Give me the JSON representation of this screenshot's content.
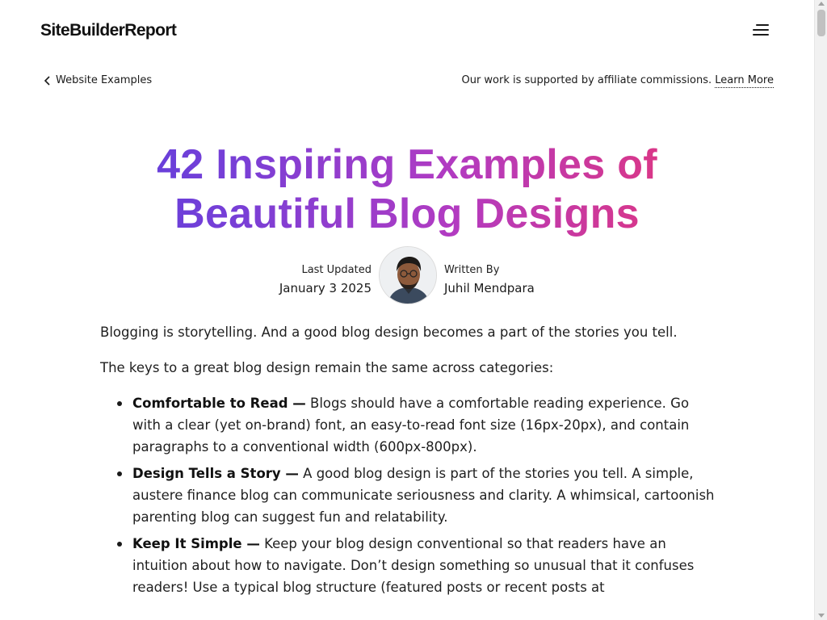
{
  "header": {
    "logo": "SiteBuilderReport",
    "menu_icon": "hamburger-icon"
  },
  "nav": {
    "back_label": "Website Examples",
    "back_icon": "chevron-left-icon",
    "affiliate_text": "Our work is supported by affiliate commissions.",
    "affiliate_link": "Learn More"
  },
  "article": {
    "title_line1": "42 Inspiring Examples of",
    "title_line2": "Beautiful Blog Designs",
    "title_gradient": [
      "#4b3fe0",
      "#e8366c"
    ],
    "updated_label": "Last Updated",
    "updated_date": "January 3 2025",
    "author_label": "Written By",
    "author_name": "Juhil Mendpara",
    "intro_p1": "Blogging is storytelling. And a good blog design becomes a part of the stories you tell.",
    "intro_p2": "The keys to a great blog design remain the same across categories:",
    "bullets": [
      {
        "heading": "Comfortable to Read —",
        "text": " Blogs should have a comfortable reading experience. Go with a clear (yet on-brand) font, an easy-to-read font size (16px-20px), and contain paragraphs to a conventional width (600px-800px)."
      },
      {
        "heading": "Design Tells a Story —",
        "text": " A good blog design is part of the stories you tell. A simple, austere finance blog can communicate seriousness and clarity. A whimsical, cartoonish parenting blog can suggest fun and relatability."
      },
      {
        "heading": "Keep It Simple —",
        "text": " Keep your blog design conventional so that readers have an intuition about how to navigate. Don’t design something so unusual that it confuses readers! Use a typical blog structure (featured posts or recent posts at"
      }
    ]
  }
}
